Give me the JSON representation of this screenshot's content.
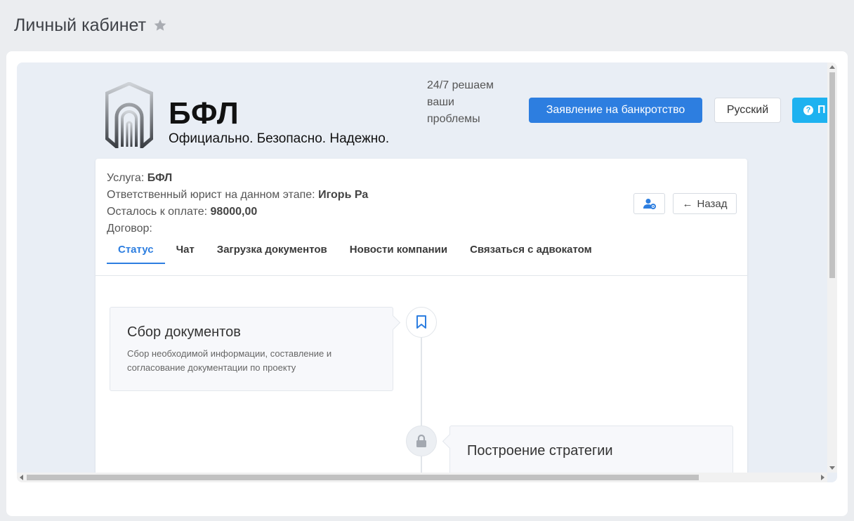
{
  "page": {
    "title": "Личный кабинет"
  },
  "brand": {
    "name": "БФЛ",
    "tagline": "Официально. Безопасно. Надежно.",
    "support_text": "24/7 решаем ваши проблемы"
  },
  "header_buttons": {
    "apply_label": "Заявление на банкротство",
    "language_label": "Русский",
    "help_label": "П"
  },
  "info": {
    "service_label": "Услуга:",
    "service_value": "БФЛ",
    "lawyer_label": "Ответственный юрист на данном этапе:",
    "lawyer_value": "Игорь Ра",
    "payment_label": "Осталось к оплате:",
    "payment_value": "98000,00",
    "contract_label": "Договор:"
  },
  "actions": {
    "back_label": "Назад"
  },
  "tabs": [
    {
      "label": "Статус",
      "active": true
    },
    {
      "label": "Чат"
    },
    {
      "label": "Загрузка документов"
    },
    {
      "label": "Новости компании"
    },
    {
      "label": "Связаться с адвокатом"
    }
  ],
  "timeline": [
    {
      "title": "Сбор документов",
      "description": "Сбор необходимой информации, составление и согласование документации по проекту",
      "icon": "bookmark-icon"
    },
    {
      "title": "Построение стратегии",
      "description": "",
      "icon": "lock-icon"
    }
  ],
  "colors": {
    "primary": "#2d7ee0",
    "help": "#1eb2f0",
    "page_bg": "#ebedf0",
    "frame_bg": "#e9eef5"
  }
}
